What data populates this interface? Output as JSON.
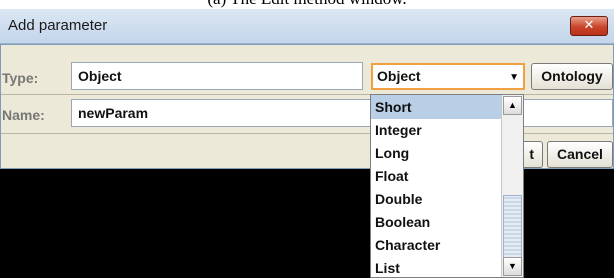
{
  "caption": "(a) The Edit method window.",
  "window": {
    "title": "Add parameter",
    "close_glyph": "✕"
  },
  "form": {
    "type_label": "Type:",
    "type_value": "Object",
    "type_combo_value": "Object",
    "ontology_button": "Ontology",
    "name_label": "Name:",
    "name_value": "newParam",
    "ok_button_partial": "t",
    "cancel_button": "Cancel"
  },
  "dropdown": {
    "options": [
      "Short",
      "Integer",
      "Long",
      "Float",
      "Double",
      "Boolean",
      "Character",
      "List"
    ],
    "selected": "Short"
  }
}
